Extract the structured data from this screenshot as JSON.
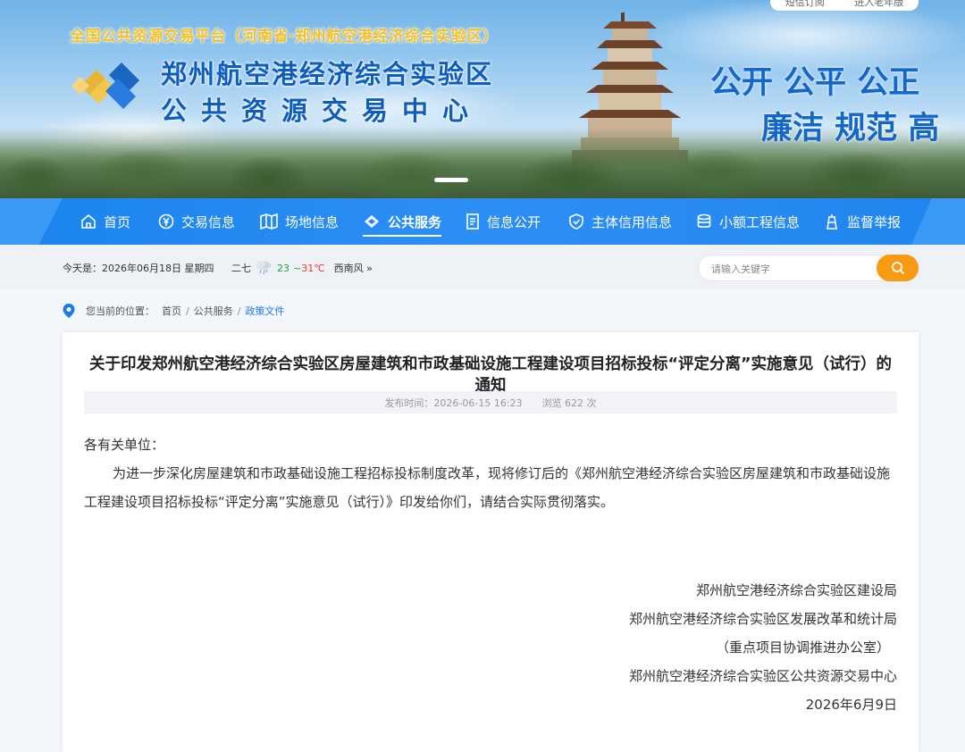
{
  "banner": {
    "top_links": [
      "短信订阅",
      "进入老年版"
    ],
    "platform_tag": "全国公共资源交易平台（河南省·郑州航空港经济综合实验区）",
    "org_name_line1": "郑州航空港经济综合实验区",
    "org_name_line2": "公共资源交易中心",
    "slogan_line1": "公开  公平  公正",
    "slogan_line2": "廉洁  规范  高"
  },
  "nav": {
    "items": [
      {
        "label": "首页",
        "icon": "home-icon"
      },
      {
        "label": "交易信息",
        "icon": "yen-icon"
      },
      {
        "label": "场地信息",
        "icon": "map-icon"
      },
      {
        "label": "公共服务",
        "icon": "diamond-icon",
        "active": true
      },
      {
        "label": "信息公开",
        "icon": "document-icon"
      },
      {
        "label": "主体信用信息",
        "icon": "shield-icon"
      },
      {
        "label": "小额工程信息",
        "icon": "database-icon"
      },
      {
        "label": "监督举报",
        "icon": "tower-icon"
      }
    ]
  },
  "infobar": {
    "date_text": "今天是：2026年06月18日 星期四",
    "weather_label": "二七",
    "temp_low": "23",
    "temp_sep": "~",
    "temp_high": "31℃",
    "wind": "西南风 »",
    "search_placeholder": "请输入关键字"
  },
  "breadcrumb": {
    "prefix": "您当前的位置：",
    "items": [
      "首页",
      "公共服务",
      "政策文件"
    ]
  },
  "article": {
    "title": "关于印发郑州航空港经济综合实验区房屋建筑和市政基础设施工程建设项目招标投标“评定分离”实施意见（试行）的通知",
    "publish_time": "发布时间：2026-06-15 16:23",
    "views": "浏览 622 次",
    "salutation": "各有关单位：",
    "paragraph": "为进一步深化房屋建筑和市政基础设施工程招标投标制度改革，现将修订后的《郑州航空港经济综合实验区房屋建筑和市政基础设施工程建设项目招标投标“评定分离”实施意见（试行）》印发给你们，请结合实际贯彻落实。",
    "signatures": [
      "郑州航空港经济综合实验区建设局",
      "郑州航空港经济综合实验区发展改革和统计局",
      "（重点项目协调推进办公室）",
      "郑州航空港经济综合实验区公共资源交易中心",
      "2026年6月9日"
    ]
  },
  "colors": {
    "nav_blue": "#1f86ef",
    "search_orange": "#f89a12",
    "link_blue": "#1a7ae6",
    "org_blue": "#0d5cc0",
    "tag_gold": "#f4c02a"
  }
}
